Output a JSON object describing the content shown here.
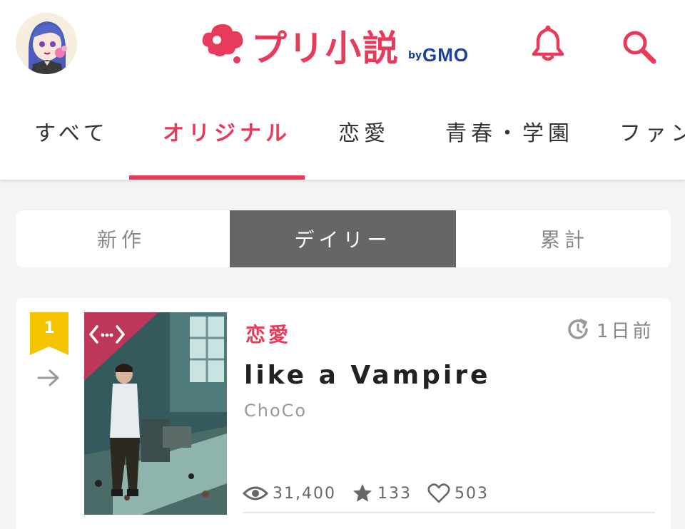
{
  "header": {
    "logo_text": "プリ小説",
    "logo_by": "by",
    "logo_gmo": "GMO"
  },
  "tabs": [
    {
      "label": "すべて",
      "active": false
    },
    {
      "label": "オリジナル",
      "active": true
    },
    {
      "label": "恋愛",
      "active": false
    },
    {
      "label": "青春・学園",
      "active": false
    },
    {
      "label": "ファン",
      "active": false
    }
  ],
  "ranking_switch": [
    {
      "label": "新作",
      "active": false
    },
    {
      "label": "デイリー",
      "active": true
    },
    {
      "label": "累計",
      "active": false
    }
  ],
  "story": {
    "rank": "1",
    "genre": "恋愛",
    "updated": "1日前",
    "title": "like a Vampire",
    "author": "ChoCo",
    "views": "31,400",
    "stars": "133",
    "likes": "503"
  },
  "icons": {
    "bell": "bell-icon",
    "search": "search-icon",
    "rank_change": "arrow-right-icon",
    "time": "history-icon",
    "views": "eye-icon",
    "stars": "star-icon",
    "likes": "heart-icon",
    "cover_badge": "code-brackets-icon"
  },
  "colors": {
    "brand": "#e83a5a",
    "gmo": "#1a3f9c",
    "rank_badge": "#f5c400",
    "segment_active": "#666666"
  }
}
